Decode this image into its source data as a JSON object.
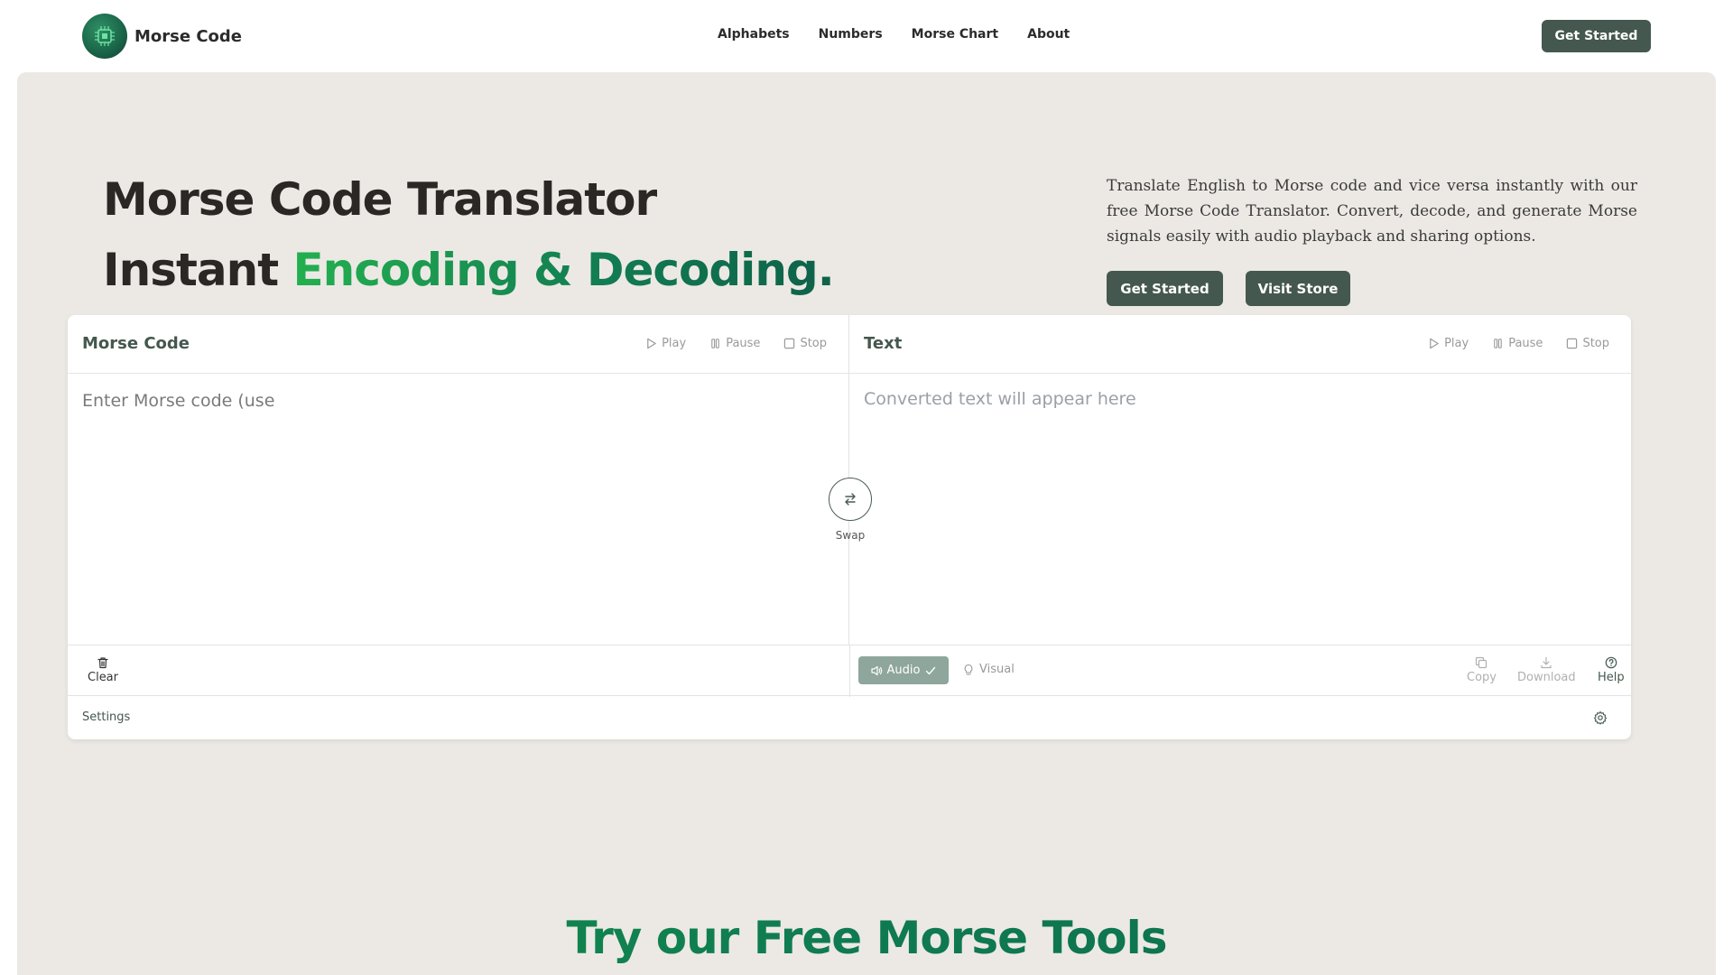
{
  "brand": {
    "name": "Morse Code"
  },
  "nav": {
    "links": [
      "Alphabets",
      "Numbers",
      "Morse Chart",
      "About"
    ],
    "cta": "Get Started"
  },
  "hero": {
    "title_line1": "Morse Code Translator",
    "title_line2_prefix": "Instant ",
    "title_line2_highlight": "Encoding & Decoding.",
    "description": "Translate English to Morse code and vice versa instantly with our free Morse Code Translator. Convert, decode, and generate Morse signals easily with audio playback and sharing options.",
    "primary_button": "Get Started",
    "secondary_button": "Visit Store"
  },
  "translator": {
    "left": {
      "title": "Morse Code",
      "placeholder": "Enter Morse code (use",
      "play": "Play",
      "pause": "Pause",
      "stop": "Stop"
    },
    "right": {
      "title": "Text",
      "placeholder": "Converted text will appear here",
      "play": "Play",
      "pause": "Pause",
      "stop": "Stop"
    },
    "swap": "Swap",
    "toolbar": {
      "clear": "Clear",
      "audio": "Audio",
      "visual": "Visual",
      "copy": "Copy",
      "download": "Download",
      "help": "Help"
    },
    "settings": "Settings"
  },
  "tools_section": {
    "heading": "Try our Free Morse Tools"
  },
  "colors": {
    "accent": "#44584f",
    "hero_bg": "#ece9e5",
    "green_highlight": "#23b04f",
    "green_dark": "#0e6149"
  }
}
